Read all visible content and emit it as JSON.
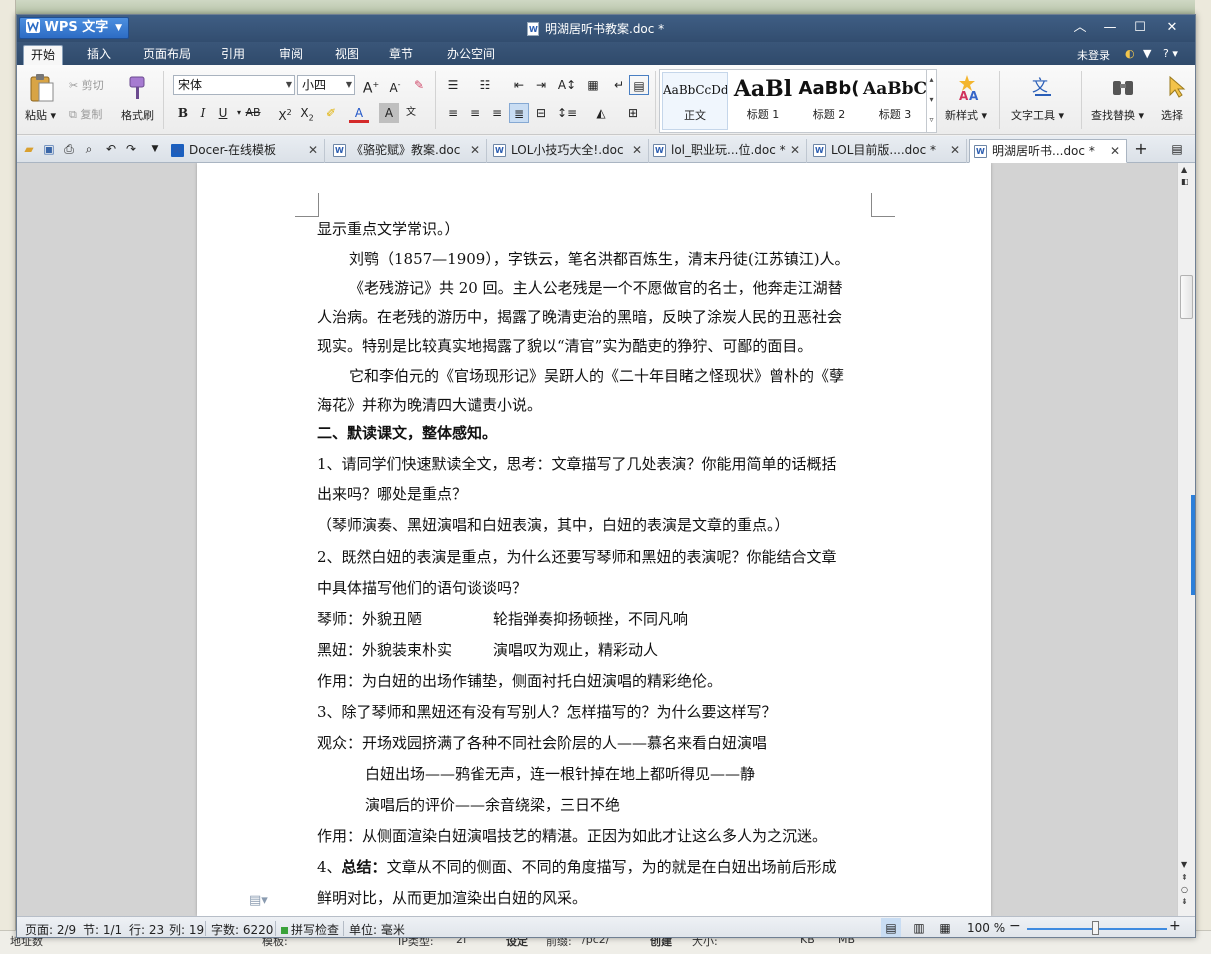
{
  "window": {
    "app_name": "WPS 文字",
    "doc_title": "明湖居听书教案.doc *",
    "login": "未登录"
  },
  "menu": {
    "tabs": [
      "开始",
      "插入",
      "页面布局",
      "引用",
      "审阅",
      "视图",
      "章节",
      "办公空间"
    ]
  },
  "ribbon": {
    "paste": "粘贴",
    "cut": "剪切",
    "copy": "复制",
    "format_painter": "格式刷",
    "font_name": "宋体",
    "font_size": "小四",
    "styles": [
      {
        "preview": "AaBbCcDd",
        "name": "正文"
      },
      {
        "preview": "AaBl",
        "name": "标题 1"
      },
      {
        "preview": "AaBb(",
        "name": "标题 2"
      },
      {
        "preview": "AaBbC",
        "name": "标题 3"
      }
    ],
    "new_style": "新样式",
    "text_tools": "文字工具",
    "find_replace": "查找替换",
    "select": "选择"
  },
  "doc_tabs": [
    {
      "label": "Docer-在线模板"
    },
    {
      "label": "《骆驼赋》教案.doc"
    },
    {
      "label": "LOL小技巧大全!.doc"
    },
    {
      "label": "lol_职业玩...位.doc *"
    },
    {
      "label": "LOL目前版....doc *"
    },
    {
      "label": "明湖居听书...doc *"
    }
  ],
  "document": {
    "lines": [
      "显示重点文学常识。）",
      "刘鹗（1857—1909），字铁云，笔名洪都百炼生，清末丹徒(江苏镇江)人。",
      "《老残游记》共 20 回。主人公老残是一个不愿做官的名士，他奔走江湖替",
      "人治病。在老残的游历中，揭露了晚清吏治的黑暗，反映了涂炭人民的丑恶社会",
      "现实。特别是比较真实地揭露了貌以“清官”实为酷吏的狰狞、可鄙的面目。",
      "它和李伯元的《官场现形记》吴趼人的《二十年目睹之怪现状》曾朴的《孽",
      "海花》并称为晚清四大谴责小说。",
      "二、默读课文，整体感知。",
      "1、请同学们快速默读全文，思考：文章描写了几处表演？你能用简单的话概括",
      "出来吗？哪处是重点？",
      "（琴师演奏、黑妞演唱和白妞表演，其中，白妞的表演是文章的重点。）",
      "2、既然白妞的表演是重点，为什么还要写琴师和黑妞的表演呢？你能结合文章",
      "中具体描写他们的语句谈谈吗？",
      "琴师：外貌丑陋",
      "轮指弹奏抑扬顿挫，不同凡响",
      "黑妞：外貌装束朴实",
      "演唱叹为观止，精彩动人",
      "作用：为白妞的出场作铺垫，侧面衬托白妞演唱的精彩绝伦。",
      "3、除了琴师和黑妞还有没有写别人？怎样描写的？为什么要这样写？",
      "观众：开场戏园挤满了各种不同社会阶层的人——慕名来看白妞演唱",
      "白妞出场——鸦雀无声，连一根针掉在地上都听得见——静",
      "演唱后的评价——余音绕梁，三日不绝",
      "作用：从侧面渲染白妞演唱技艺的精湛。正因为如此才让这么多人为之沉迷。",
      "4、",
      "总结：",
      "文章从不同的侧面、不同的角度描写，为的就是在白妞出场前后形成",
      "鲜明对比，从而更加渲染出白妞的风采。"
    ]
  },
  "status": {
    "page": "页面: 2/9",
    "section": "节: 1/1",
    "row": "行: 23",
    "col": "列: 19",
    "words": "字数: 6220",
    "spell": "拼写检查",
    "unit": "单位: 毫米",
    "zoom": "100 %",
    "zoom_level": 0.5
  },
  "desktop": {
    "bottom_labels": [
      "地址数",
      "模板:",
      "IP类型:",
      "2f",
      "设定",
      "前缀:",
      "/pc2/",
      "创建",
      "大小:",
      "KB",
      "MB"
    ]
  }
}
